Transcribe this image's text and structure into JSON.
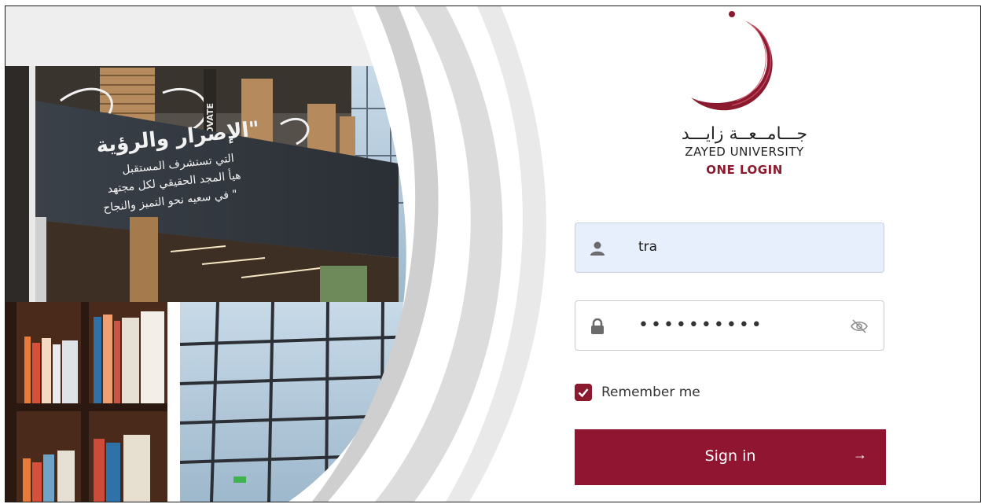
{
  "brand": {
    "arabic_name": "جـــامــعــة زايـــد",
    "english_name": "ZAYED UNIVERSITY",
    "product": "ONE LOGIN",
    "accent_color": "#8b1a2e"
  },
  "hero": {
    "sign_arabic_title": "الإصرار والرؤية\"",
    "sign_arabic_lines": [
      "التي تستشرف المستقبل",
      "هيأ المجد الحقيقي لكل مجتهد",
      "في سعيه نحو التميز والنجاح \""
    ],
    "innovate_text": "INNOVATE"
  },
  "form": {
    "username": {
      "value": "tra",
      "icon": "user-icon"
    },
    "password": {
      "masked_value": "••••••••••",
      "icon": "lock-icon",
      "toggle_icon": "eye-slash-icon"
    },
    "remember": {
      "label": "Remember me",
      "checked": true
    },
    "submit": {
      "label": "Sign in",
      "arrow": "→"
    }
  }
}
